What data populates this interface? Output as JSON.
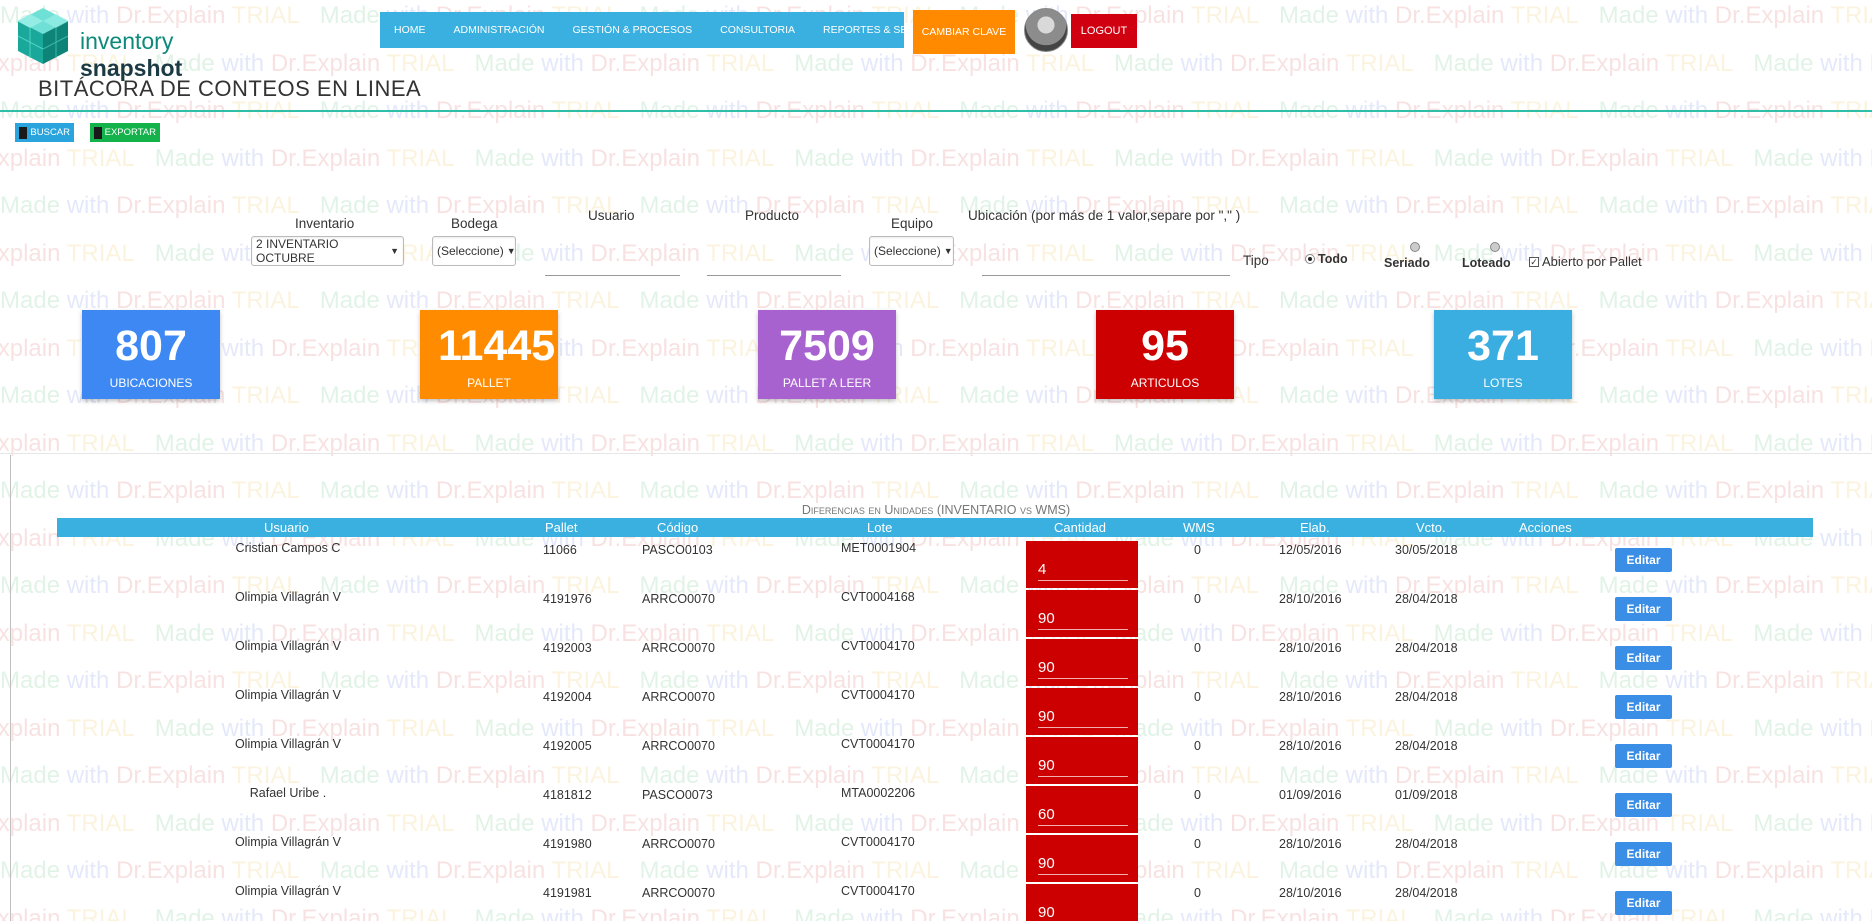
{
  "brand": {
    "name_part1": "inventory",
    "name_part2": "snapshot"
  },
  "nav": {
    "items": [
      "HOME",
      "ADMINISTRACIÓN",
      "GESTIÓN & PROCESOS",
      "CONSULTORIA",
      "REPORTES & SERVICIOS"
    ],
    "change_password": "CAMBIAR CLAVE",
    "logout": "LOGOUT"
  },
  "page": {
    "title": "BITÁCORA DE CONTEOS EN LINEA"
  },
  "toolbar": {
    "search": "BUSCAR",
    "export": "EXPORTAR"
  },
  "filters": {
    "inventario": {
      "label": "Inventario",
      "value": "2 INVENTARIO OCTUBRE"
    },
    "bodega": {
      "label": "Bodega",
      "value": "(Seleccione)"
    },
    "usuario": {
      "label": "Usuario",
      "value": ""
    },
    "producto": {
      "label": "Producto",
      "value": ""
    },
    "equipo": {
      "label": "Equipo",
      "value": "(Seleccione)"
    },
    "ubicacion": {
      "label": "Ubicación (por más de 1 valor,separe por \",\" )",
      "value": ""
    },
    "tipo": {
      "label": "Tipo",
      "options": [
        "Todo",
        "Seriado",
        "Loteado"
      ],
      "selected": "Todo"
    },
    "abierto_por_pallet": {
      "label": "Abierto por Pallet",
      "checked": true
    }
  },
  "stats": [
    {
      "value": "807",
      "label": "UBICACIONES",
      "color": "#3d88f2"
    },
    {
      "value": "11445",
      "label": "PALLET",
      "color": "#ff8c00"
    },
    {
      "value": "7509",
      "label": "PALLET A LEER",
      "color": "#a862d0"
    },
    {
      "value": "95",
      "label": "ARTICULOS",
      "color": "#cc0000"
    },
    {
      "value": "371",
      "label": "LOTES",
      "color": "#3aaee0"
    }
  ],
  "table": {
    "caption": "Diferencias en Unidades (INVENTARIO vs WMS)",
    "headers": [
      "Usuario",
      "Pallet",
      "Código",
      "Lote",
      "Cantidad",
      "WMS",
      "Elab.",
      "Vcto.",
      "Acciones"
    ],
    "edit_label": "Editar",
    "rows": [
      [
        "Cristian Campos C",
        "11066",
        "PASCO0103",
        "MET0001904",
        "4",
        "0",
        "12/05/2016",
        "30/05/2018"
      ],
      [
        "Olimpia Villagrán V",
        "4191976",
        "ARRCO0070",
        "CVT0004168",
        "90",
        "0",
        "28/10/2016",
        "28/04/2018"
      ],
      [
        "Olimpia Villagrán V",
        "4192003",
        "ARRCO0070",
        "CVT0004170",
        "90",
        "0",
        "28/10/2016",
        "28/04/2018"
      ],
      [
        "Olimpia Villagrán V",
        "4192004",
        "ARRCO0070",
        "CVT0004170",
        "90",
        "0",
        "28/10/2016",
        "28/04/2018"
      ],
      [
        "Olimpia Villagrán V",
        "4192005",
        "ARRCO0070",
        "CVT0004170",
        "90",
        "0",
        "28/10/2016",
        "28/04/2018"
      ],
      [
        "Rafael Uribe .",
        "4181812",
        "PASCO0073",
        "MTA0002206",
        "60",
        "0",
        "01/09/2016",
        "01/09/2018"
      ],
      [
        "Olimpia Villagrán V",
        "4191980",
        "ARRCO0070",
        "CVT0004170",
        "90",
        "0",
        "28/10/2016",
        "28/04/2018"
      ],
      [
        "Olimpia Villagrán V",
        "4191981",
        "ARRCO0070",
        "CVT0004170",
        "90",
        "0",
        "28/10/2016",
        "28/04/2018"
      ]
    ]
  },
  "watermark": {
    "made": "Made",
    "with": "with",
    "dr": "Dr.Explain",
    "trial": "TRIAL"
  }
}
